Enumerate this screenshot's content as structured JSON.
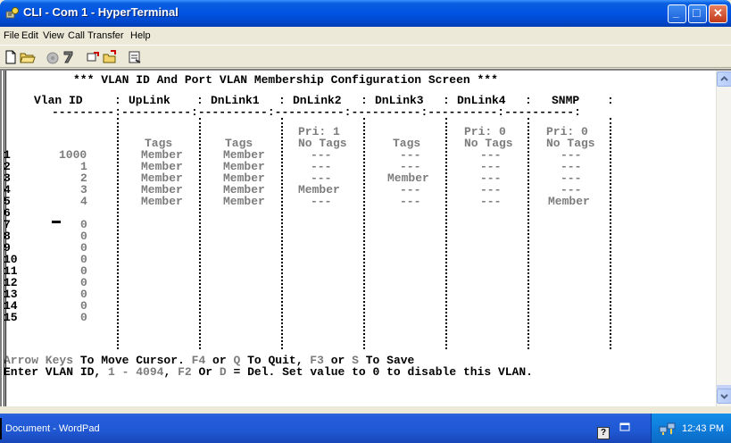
{
  "window": {
    "title": "CLI - Com 1 - HyperTerminal",
    "minimize_glyph": "_",
    "maximize_glyph": "□",
    "close_glyph": "✕"
  },
  "menu": [
    "File",
    "Edit",
    "View",
    "Call",
    "Transfer",
    "Help"
  ],
  "toolbar": {
    "icons": [
      "new-icon",
      "open-icon",
      "disconnect-icon",
      "send-icon",
      "call-icon",
      "hangup-icon",
      "properties-icon"
    ]
  },
  "terminal": {
    "screen_title": "*** VLAN ID And Port VLAN Membership Configuration Screen ***",
    "headers": [
      "Vlan ID",
      "UpLink",
      "DnLink1",
      "DnLink2",
      "DnLink3",
      "DnLink4",
      "SNMP"
    ],
    "separator_row": "---------:----------:----------:----------:----------:----------:----------:",
    "priority_row": [
      "",
      "",
      "",
      "Pri: 1",
      "",
      "Pri: 0",
      "Pri: 0"
    ],
    "tags_row": [
      "",
      "Tags",
      "Tags",
      "No Tags",
      "Tags",
      "No Tags",
      "No Tags"
    ],
    "rows": [
      {
        "num": "1",
        "vlan": "1000",
        "cells": [
          "Member",
          "Member",
          "---",
          "---",
          "---",
          "---"
        ]
      },
      {
        "num": "2",
        "vlan": "1",
        "cells": [
          "Member",
          "Member",
          "---",
          "---",
          "---",
          "---"
        ]
      },
      {
        "num": "3",
        "vlan": "2",
        "cells": [
          "Member",
          "Member",
          "---",
          "Member",
          "---",
          "---"
        ]
      },
      {
        "num": "4",
        "vlan": "3",
        "cells": [
          "Member",
          "Member",
          "Member",
          "---",
          "---",
          "---"
        ]
      },
      {
        "num": "5",
        "vlan": "4",
        "cells": [
          "Member",
          "Member",
          "---",
          "---",
          "---",
          "Member"
        ]
      },
      {
        "num": "6",
        "vlan": "",
        "cells": [
          "",
          "",
          "",
          "",
          "",
          ""
        ]
      },
      {
        "num": "7",
        "vlan": "0",
        "cells": [
          "",
          "",
          "",
          "",
          "",
          ""
        ]
      },
      {
        "num": "8",
        "vlan": "0",
        "cells": [
          "",
          "",
          "",
          "",
          "",
          ""
        ]
      },
      {
        "num": "9",
        "vlan": "0",
        "cells": [
          "",
          "",
          "",
          "",
          "",
          ""
        ]
      },
      {
        "num": "10",
        "vlan": "0",
        "cells": [
          "",
          "",
          "",
          "",
          "",
          ""
        ]
      },
      {
        "num": "11",
        "vlan": "0",
        "cells": [
          "",
          "",
          "",
          "",
          "",
          ""
        ]
      },
      {
        "num": "12",
        "vlan": "0",
        "cells": [
          "",
          "",
          "",
          "",
          "",
          ""
        ]
      },
      {
        "num": "13",
        "vlan": "0",
        "cells": [
          "",
          "",
          "",
          "",
          "",
          ""
        ]
      },
      {
        "num": "14",
        "vlan": "0",
        "cells": [
          "",
          "",
          "",
          "",
          "",
          ""
        ]
      },
      {
        "num": "15",
        "vlan": "0",
        "cells": [
          "",
          "",
          "",
          "",
          "",
          ""
        ]
      }
    ],
    "help_line1": {
      "gray1": "Arrow Keys",
      "text1": " To Move Cursor. ",
      "gray2": "F4",
      "text2": " or ",
      "gray3": "Q",
      "text3": " To Quit, ",
      "gray4": "F3",
      "text4": " or ",
      "gray5": "S",
      "text5": " To Save"
    },
    "help_line2": {
      "text1": "Enter VLAN ID, ",
      "gray1": "1 - 4094",
      "text2": ", ",
      "gray2": "F2",
      "text3": " Or ",
      "gray3": "D",
      "text4": " = Del. Set value to 0 to disable this VLAN."
    }
  },
  "taskbar": {
    "task": "Document - WordPad",
    "clock": "12:43 PM",
    "help_glyph": "?"
  },
  "colors": {
    "title_blue": "#0054e3",
    "gray_text": "#7c7c7c"
  }
}
